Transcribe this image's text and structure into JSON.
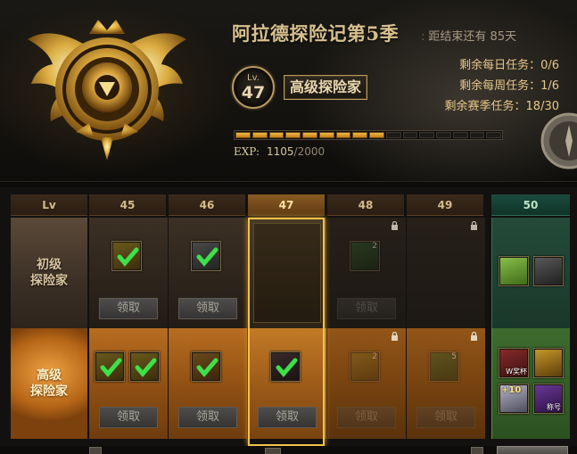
{
  "header": {
    "title": "阿拉德探险记第5季",
    "countdown_label": "距结束还有",
    "countdown_value": "85天",
    "level_prefix": "Lv.",
    "level": "47",
    "rank_title": "高级探险家",
    "tasks": {
      "daily_label": "剩余每日任务：",
      "daily_value": "0/6",
      "weekly_label": "剩余每周任务：",
      "weekly_value": "1/6",
      "season_label": "剩余赛季任务：",
      "season_value": "18/30"
    },
    "exp": {
      "label": "EXP:",
      "current": "1105",
      "total": "/2000",
      "filled_segments": 9,
      "segments": 16
    }
  },
  "grid": {
    "lv_header": "Lv",
    "levels": [
      "45",
      "46",
      "47",
      "48",
      "49"
    ],
    "final_level": "50",
    "row1_label_line1": "初级",
    "row1_label_line2": "探险家",
    "row2_label_line1": "高级",
    "row2_label_line2": "探险家",
    "claim_label": "领取",
    "reward_counts": {
      "r1_48": "2",
      "r2_48": "2",
      "r2_49": "5"
    },
    "final_badges": {
      "r2_a": "W奖杯",
      "r2_b": "+10",
      "r2_c": "称号"
    }
  },
  "colors": {
    "accent_gold": "#f2c24a",
    "title": "#d7c08f",
    "task_text": "#e8c78a",
    "exp_fill": "#e9a93a",
    "final_column": "#1b4b3e"
  }
}
